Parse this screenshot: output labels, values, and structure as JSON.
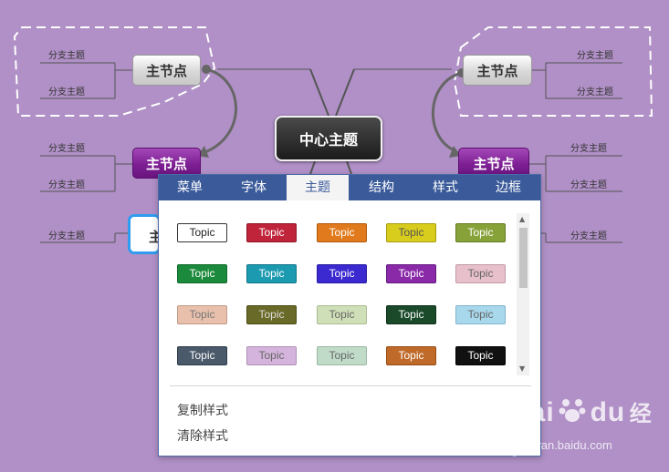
{
  "mindmap": {
    "center_topic": "中心主题",
    "main_node_label": "主节点",
    "branch_label": "分支主题"
  },
  "panel": {
    "tabs": [
      "菜单",
      "字体",
      "主题",
      "结构",
      "样式",
      "边框"
    ],
    "active_tab": "主题",
    "topic_label": "Topic",
    "styles": [
      {
        "bg": "#ffffff",
        "fg": "#222222",
        "border": "#333333"
      },
      {
        "bg": "#c0243a",
        "fg": "#ffffff",
        "border": "#8c1424"
      },
      {
        "bg": "#e07a1c",
        "fg": "#ffffff",
        "border": "#b0580c"
      },
      {
        "bg": "#d8cc1c",
        "fg": "#555555",
        "border": "#a89c10"
      },
      {
        "bg": "#88a23a",
        "fg": "#ffffff",
        "border": "#637a22"
      },
      {
        "bg": "#1c8a3c",
        "fg": "#ffffff",
        "border": "#0f6a28"
      },
      {
        "bg": "#1c9ab0",
        "fg": "#ffffff",
        "border": "#107488"
      },
      {
        "bg": "#3a2ad0",
        "fg": "#ffffff",
        "border": "#261aa0"
      },
      {
        "bg": "#8a2aa8",
        "fg": "#ffffff",
        "border": "#661a80"
      },
      {
        "bg": "#e8c0cc",
        "fg": "#666666",
        "border": "#c09aa4"
      },
      {
        "bg": "#e8c0ac",
        "fg": "#777777",
        "border": "#c09a88"
      },
      {
        "bg": "#6a6a28",
        "fg": "#dddddd",
        "border": "#4a4a14"
      },
      {
        "bg": "#cfe0b8",
        "fg": "#666666",
        "border": "#a8bc90"
      },
      {
        "bg": "#1a4a2a",
        "fg": "#ffffff",
        "border": "#0c3018"
      },
      {
        "bg": "#a8d8ec",
        "fg": "#666666",
        "border": "#80b4cc"
      },
      {
        "bg": "#4a5a6a",
        "fg": "#ffffff",
        "border": "#2e3c4a"
      },
      {
        "bg": "#d4b4dc",
        "fg": "#666666",
        "border": "#b090b8"
      },
      {
        "bg": "#c0dcc8",
        "fg": "#666666",
        "border": "#98b8a2"
      },
      {
        "bg": "#c06a2a",
        "fg": "#ffffff",
        "border": "#964c14"
      },
      {
        "bg": "#111111",
        "fg": "#ffffff",
        "border": "#000000"
      }
    ],
    "copy_style": "复制样式",
    "clear_style": "清除样式"
  },
  "watermark": {
    "text": "Bai",
    "text2": "du",
    "text3": "经验",
    "sub": "jingyan.baidu.com"
  }
}
